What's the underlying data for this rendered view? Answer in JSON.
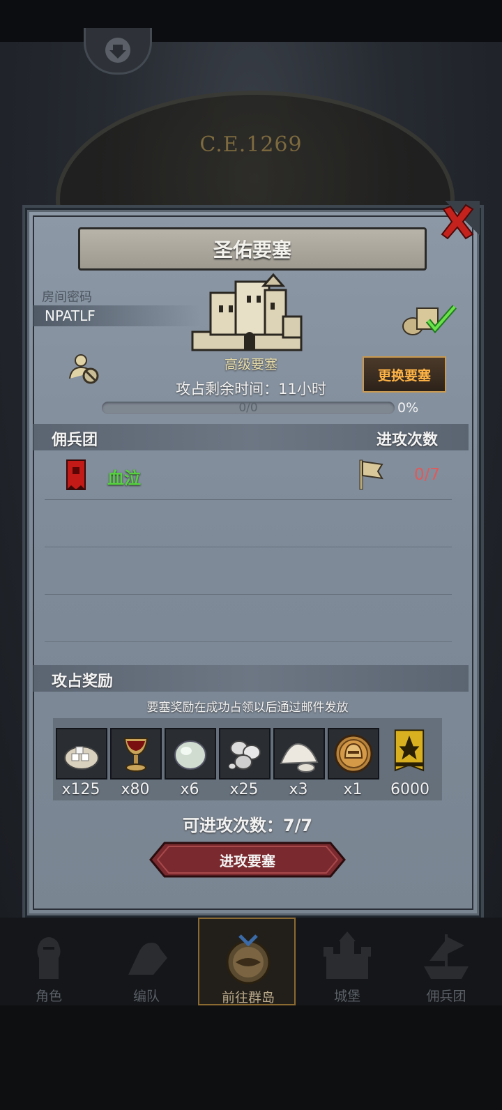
{
  "top": {
    "year_label": "C.E.1269"
  },
  "modal": {
    "title": "圣佑要塞",
    "room_label": "房间密码",
    "room_code": "NPATLF",
    "fort_level": "高级要塞",
    "remaining_time": "攻占剩余时间：11小时",
    "change_button": "更换要塞",
    "progress_text": "0/0",
    "progress_percent": "0%",
    "progress_value": 0,
    "mercenary_header": "佣兵团",
    "attack_count_header": "进攻次数",
    "mercenaries": [
      {
        "name": "血泣",
        "attacks": "0/7",
        "icon": "red-banner-icon"
      }
    ],
    "reward_header": "攻占奖励",
    "reward_note": "要塞奖励在成功占领以后通过邮件发放",
    "rewards": [
      {
        "icon": "sugar-sack-icon",
        "qty": "x125"
      },
      {
        "icon": "goblet-icon",
        "qty": "x80"
      },
      {
        "icon": "gem-stone-icon",
        "qty": "x6"
      },
      {
        "icon": "silver-coins-icon",
        "qty": "x25"
      },
      {
        "icon": "salt-pile-icon",
        "qty": "x3"
      },
      {
        "icon": "helmet-medal-icon",
        "qty": "x1"
      },
      {
        "icon": "honor-banner-icon",
        "qty": "6000"
      }
    ],
    "attack_left": "可进攻次数：7/7",
    "attack_button": "进攻要塞"
  },
  "nav": {
    "items": [
      {
        "label": "角色",
        "icon": "knight-icon"
      },
      {
        "label": "编队",
        "icon": "formation-icon"
      },
      {
        "label": "前往群岛",
        "icon": "compass-icon"
      },
      {
        "label": "城堡",
        "icon": "castle-icon"
      },
      {
        "label": "佣兵团",
        "icon": "ship-icon"
      }
    ],
    "active_index": 2
  },
  "colors": {
    "accent_gold": "#ffb446",
    "mercenary_green": "#55d23e",
    "attack_red": "#e05a5a",
    "button_red": "#7a2a2e"
  }
}
